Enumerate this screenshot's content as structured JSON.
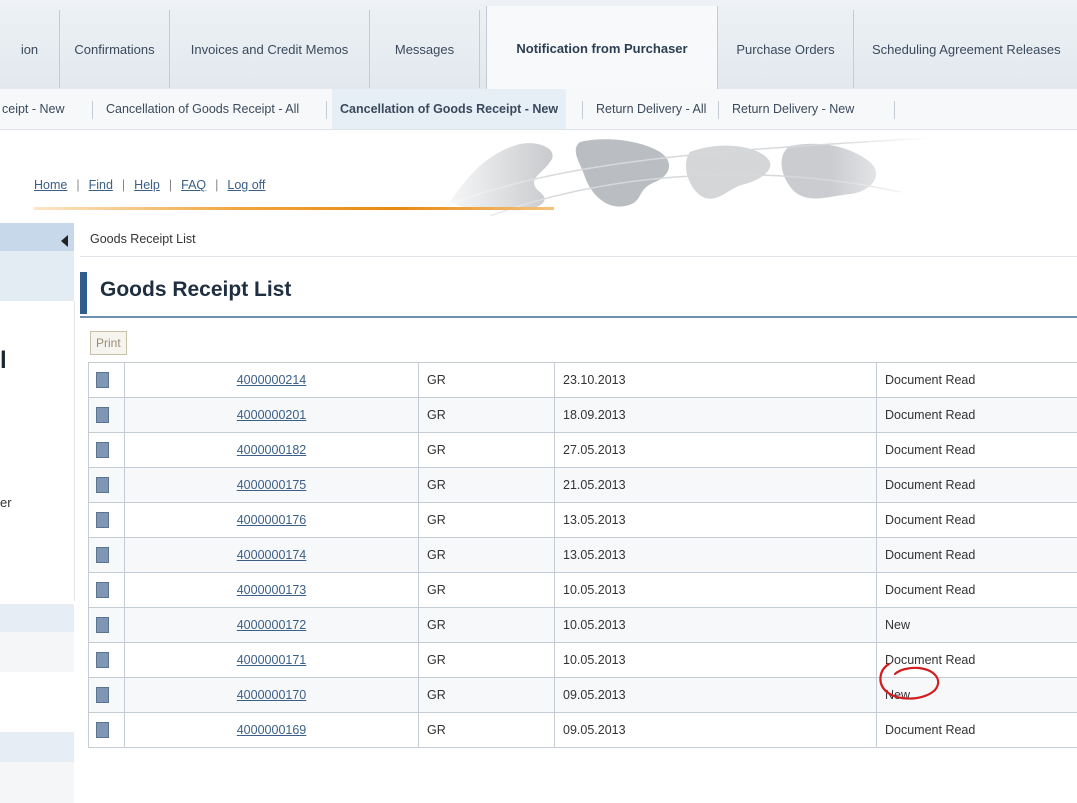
{
  "tabs": [
    {
      "label": "ion",
      "active": false
    },
    {
      "label": "Confirmations",
      "active": false
    },
    {
      "label": "Invoices and Credit Memos",
      "active": false
    },
    {
      "label": "Messages",
      "active": false
    },
    {
      "label": "Notification from Purchaser",
      "active": true
    },
    {
      "label": "Purchase Orders",
      "active": false
    },
    {
      "label": "Scheduling Agreement Releases",
      "active": false
    }
  ],
  "subtabs": [
    {
      "label": "ceipt - New",
      "active": false
    },
    {
      "label": "Cancellation of Goods Receipt - All",
      "active": false
    },
    {
      "label": "Cancellation of Goods Receipt - New",
      "active": true
    },
    {
      "label": "Return Delivery - All",
      "active": false
    },
    {
      "label": "Return Delivery - New",
      "active": false
    }
  ],
  "header_links": [
    "Home",
    "Find",
    "Help",
    "FAQ",
    "Log off"
  ],
  "leftnav": {
    "letter_1": "l",
    "letter_2": "er"
  },
  "breadcrumb": "Goods Receipt List",
  "page_title": "Goods Receipt List",
  "print_label": "Print",
  "rows": [
    {
      "number": "4000000214",
      "type": "GR",
      "date": "23.10.2013",
      "status": "Document Read"
    },
    {
      "number": "4000000201",
      "type": "GR",
      "date": "18.09.2013",
      "status": "Document Read"
    },
    {
      "number": "4000000182",
      "type": "GR",
      "date": "27.05.2013",
      "status": "Document Read"
    },
    {
      "number": "4000000175",
      "type": "GR",
      "date": "21.05.2013",
      "status": "Document Read"
    },
    {
      "number": "4000000176",
      "type": "GR",
      "date": "13.05.2013",
      "status": "Document Read"
    },
    {
      "number": "4000000174",
      "type": "GR",
      "date": "13.05.2013",
      "status": "Document Read"
    },
    {
      "number": "4000000173",
      "type": "GR",
      "date": "10.05.2013",
      "status": "Document Read"
    },
    {
      "number": "4000000172",
      "type": "GR",
      "date": "10.05.2013",
      "status": "New"
    },
    {
      "number": "4000000171",
      "type": "GR",
      "date": "10.05.2013",
      "status": "Document Read"
    },
    {
      "number": "4000000170",
      "type": "GR",
      "date": "09.05.2013",
      "status": "New"
    },
    {
      "number": "4000000169",
      "type": "GR",
      "date": "09.05.2013",
      "status": "Document Read"
    }
  ],
  "colors": {
    "title_accent": "#2f5d8c",
    "link": "#3b5f86",
    "orange_rule": "#e88a10",
    "annotation_circle": "#d21e1e",
    "doc_icon": "#7f97b3"
  }
}
